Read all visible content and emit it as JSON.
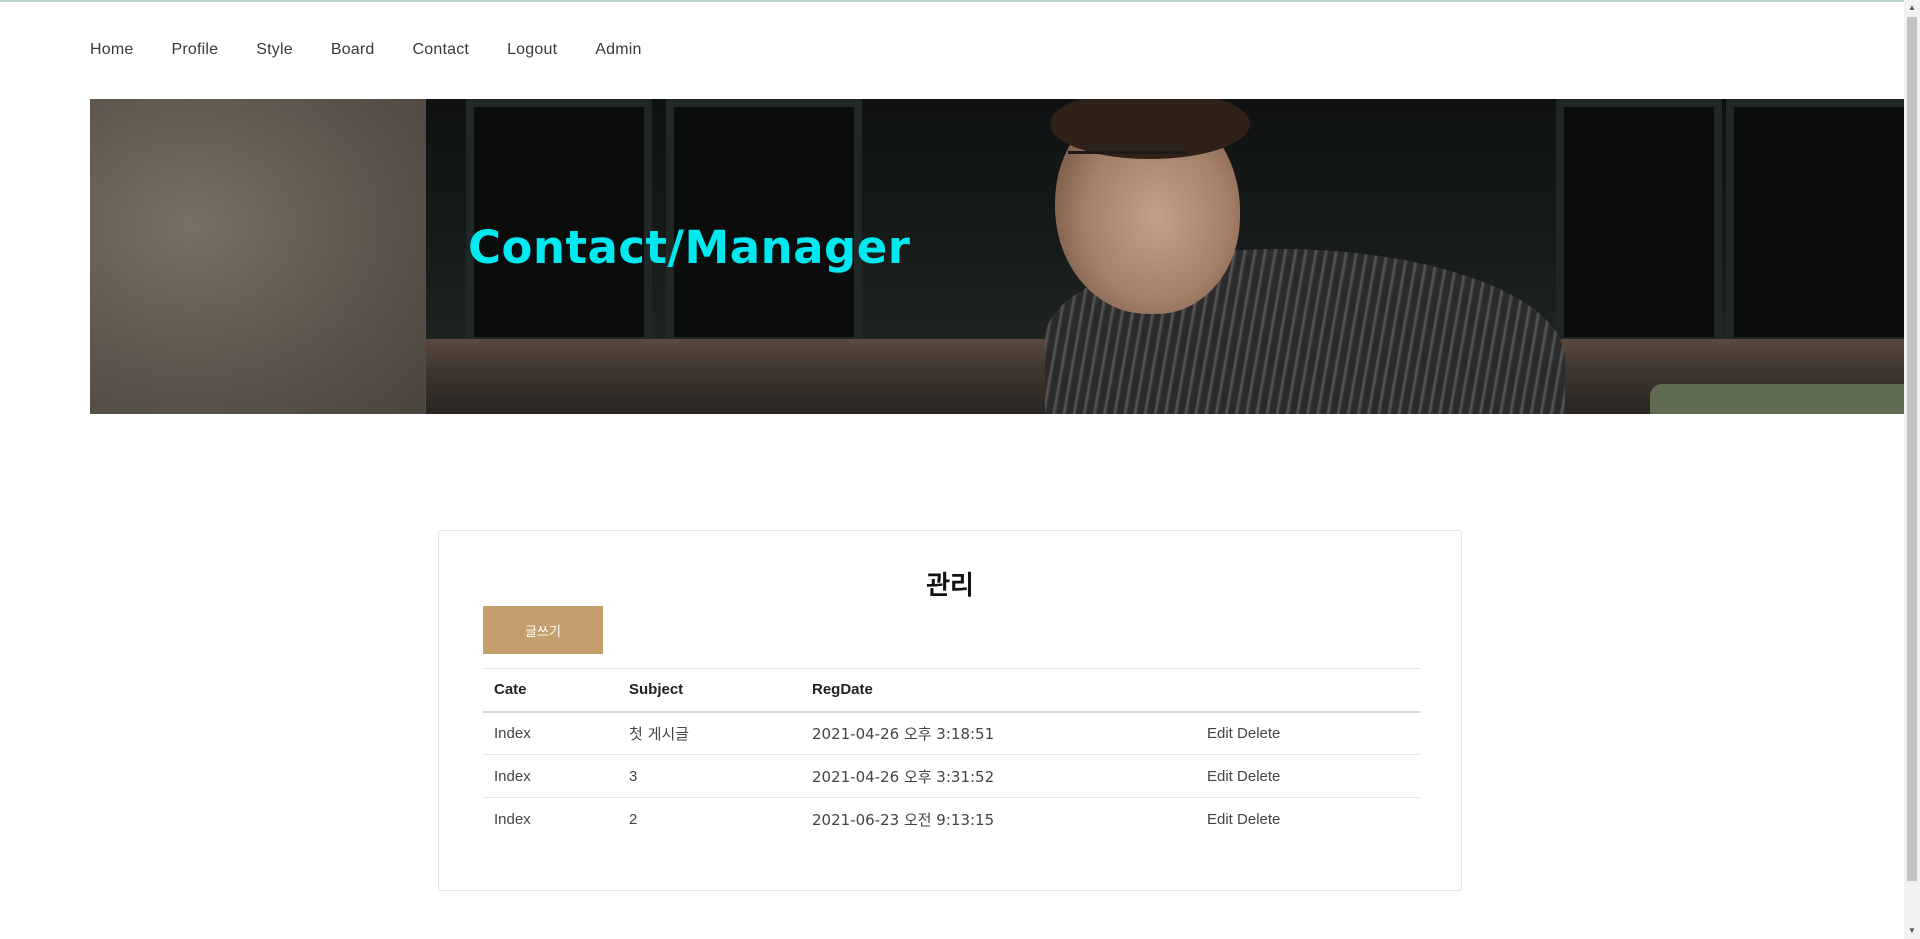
{
  "nav": {
    "items": [
      {
        "label": "Home"
      },
      {
        "label": "Profile"
      },
      {
        "label": "Style"
      },
      {
        "label": "Board"
      },
      {
        "label": "Contact"
      },
      {
        "label": "Logout"
      },
      {
        "label": "Admin"
      }
    ]
  },
  "hero": {
    "title": "Contact/Manager",
    "title_color": "#00e8f0"
  },
  "manager": {
    "title": "관리",
    "write_button": "글쓰기",
    "write_button_color": "#c49e6c",
    "columns": {
      "cate": "Cate",
      "subject": "Subject",
      "regdate": "RegDate"
    },
    "rows": [
      {
        "cate": "Index",
        "subject": "첫 게시글",
        "regdate": "2021-04-26 오후 3:18:51",
        "edit": "Edit",
        "delete": "Delete"
      },
      {
        "cate": "Index",
        "subject": "3",
        "regdate": "2021-04-26 오후 3:31:52",
        "edit": "Edit",
        "delete": "Delete"
      },
      {
        "cate": "Index",
        "subject": "2",
        "regdate": "2021-06-23 오전 9:13:15",
        "edit": "Edit",
        "delete": "Delete"
      }
    ]
  },
  "icons": {
    "scroll_up": "▲",
    "scroll_down": "▼"
  }
}
